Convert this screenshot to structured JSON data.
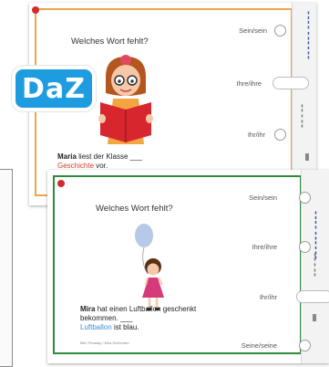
{
  "card1": {
    "title": "Welches Wort fehlt?",
    "options": [
      "Sein/sein",
      "Ihre/ihre",
      "Ihr/ihr"
    ],
    "sentence_name": "Maria",
    "sentence_rest": "liest der Klasse ___",
    "sentence_highlight": "Geschichte",
    "sentence_end": "vor."
  },
  "card2": {
    "title": "Welches Wort fehlt?",
    "options": [
      "Sein/sein",
      "Ihre/ihre",
      "Ihr/ihr",
      "Seine/seine"
    ],
    "sentence_name": "Mira",
    "sentence_rest": "hat einen Luftballon geschenkt bekommen. ___",
    "sentence_highlight": "Luftballon",
    "sentence_end": "ist blau.",
    "credit": "Bild: Pixabay / Mira Schönherr"
  },
  "badge": {
    "label": "DaZ"
  },
  "colors": {
    "card1_border": "#f0a64a",
    "card2_border": "#2e8b3e",
    "badge": "#1d9ce0",
    "red_accent": "#c8432b",
    "blue_accent": "#3a8fd4"
  }
}
